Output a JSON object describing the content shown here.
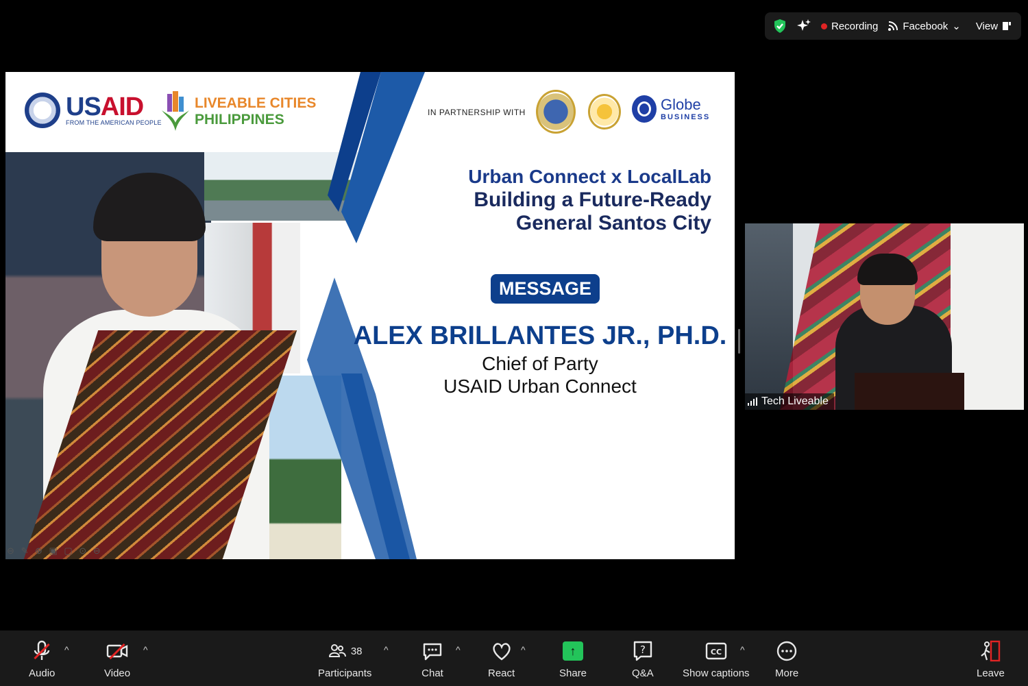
{
  "topbar": {
    "recording_label": "Recording",
    "stream_label": "Facebook",
    "view_label": "View"
  },
  "slide": {
    "usaid_name_1": "US",
    "usaid_name_2": "AID",
    "usaid_tagline": "FROM THE AMERICAN PEOPLE",
    "lcp_line1": "LIVEABLE CITIES",
    "lcp_line2": "PHILIPPINES",
    "partnership_label": "IN PARTNERSHIP WITH",
    "globe_name": "Globe",
    "globe_sub": "BUSINESS",
    "title_line1": "Urban Connect x LocalLab",
    "title_line2": "Building a Future-Ready",
    "title_line3": "General Santos City",
    "badge": "MESSAGE",
    "speaker_name": "ALEX BRILLANTES JR., PH.D.",
    "speaker_role1": "Chief of Party",
    "speaker_role2": "USAID Urban Connect"
  },
  "video_tile": {
    "participant_name": "Tech Liveable"
  },
  "toolbar": {
    "audio": "Audio",
    "video": "Video",
    "participants": "Participants",
    "participants_count": "38",
    "chat": "Chat",
    "react": "React",
    "share": "Share",
    "qa": "Q&A",
    "captions": "Show captions",
    "more": "More",
    "leave": "Leave"
  }
}
